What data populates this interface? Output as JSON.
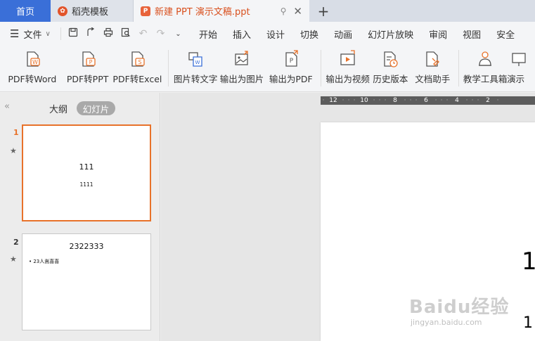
{
  "tabs": {
    "home": "首页",
    "template": "稻壳模板",
    "document": "新建 PPT 演示文稿.ppt",
    "add": "+"
  },
  "menu": {
    "file": "文件",
    "items": [
      "开始",
      "插入",
      "设计",
      "切换",
      "动画",
      "幻灯片放映",
      "审阅",
      "视图",
      "安全"
    ]
  },
  "ribbon": {
    "buttons": [
      "PDF转Word",
      "PDF转PPT",
      "PDF转Excel",
      "图片转文字",
      "输出为图片",
      "输出为PDF",
      "输出为视频",
      "历史版本",
      "文档助手",
      "教学工具箱",
      "演示"
    ]
  },
  "panel": {
    "outline_tab": "大纲",
    "slides_tab": "幻灯片",
    "slides": [
      {
        "number": "1",
        "title": "111",
        "body": "1111"
      },
      {
        "number": "2",
        "title": "2322333",
        "body": "• 23人嵩喜喜"
      }
    ]
  },
  "ruler": {
    "labels": [
      "12",
      "10",
      "8",
      "6",
      "4",
      "2"
    ]
  },
  "slide": {
    "line1": "1",
    "line2": "1"
  },
  "watermark": {
    "text": "Baidu经验",
    "url": "jingyan.baidu.com"
  },
  "colors": {
    "home_tab": "#3a6fd8",
    "accent_orange": "#e8722a",
    "document_tab_text": "#d9501e"
  }
}
